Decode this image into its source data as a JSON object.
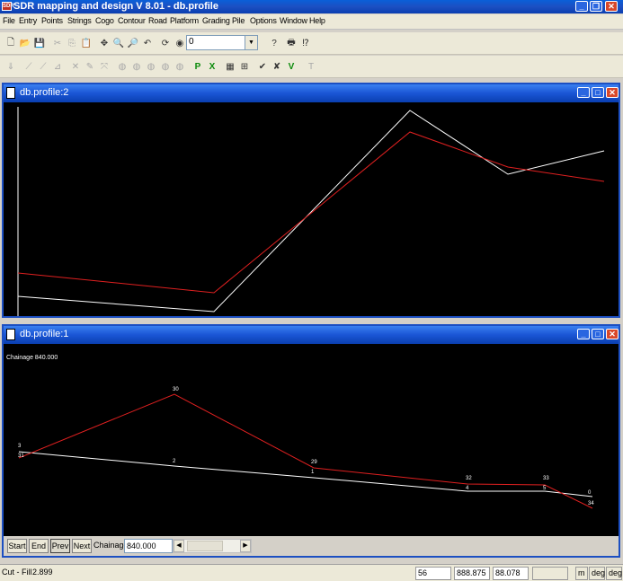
{
  "app": {
    "title": "SDR mapping and design V 8.01 - db.profile",
    "icon_text": "SDR"
  },
  "menu": [
    "File",
    "Entry",
    "Points",
    "Strings",
    "Cogo",
    "Contour",
    "Road",
    "Platform",
    "Grading",
    "Pile",
    "Options",
    "Window",
    "Help"
  ],
  "toolbar": {
    "layer_combo_value": "0"
  },
  "windows": {
    "top": {
      "title": "db.profile:2"
    },
    "bottom": {
      "title": "db.profile:1",
      "chainage_readout": "Chainage 840.000",
      "nav": {
        "start_label": "Start",
        "end_label": "End",
        "prev_label": "Prev",
        "next_label": "Next",
        "chainage_label": "Chainage",
        "chainage_value": "840.000"
      },
      "point_labels": {
        "red": [
          "3",
          "30",
          "29",
          "32",
          "33",
          "34"
        ],
        "white": [
          "31",
          "2",
          "1",
          "4",
          "5",
          "0"
        ]
      }
    }
  },
  "colors": {
    "red_line": "#e02020",
    "white_line": "#ffffff",
    "canvas_bg": "#000000"
  },
  "status": {
    "cut_fill_label": "Cut - Fill",
    "cut_fill_value": "2.899",
    "field_1": "56",
    "field_2": "888.875",
    "field_3": "88.078",
    "unit_1": "m",
    "unit_2": "deg",
    "unit_3": "deg"
  }
}
